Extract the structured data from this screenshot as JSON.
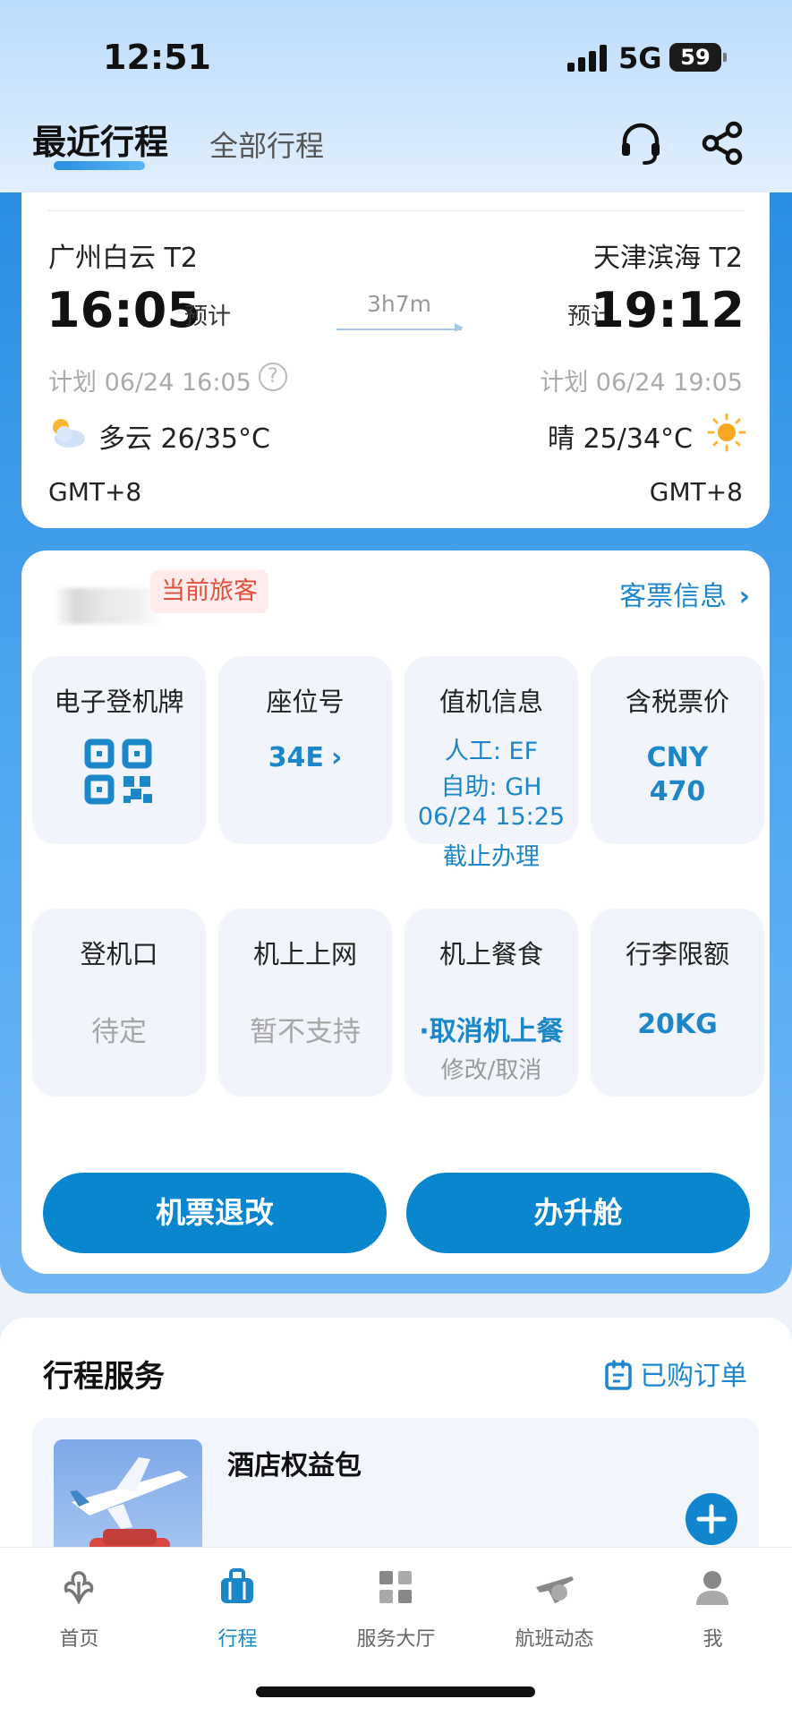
{
  "status_bar": {
    "time": "12:51",
    "network": "5G",
    "battery": "59"
  },
  "header": {
    "tabs": [
      {
        "label": "最近行程",
        "active": true
      },
      {
        "label": "全部行程",
        "active": false
      }
    ],
    "icons": [
      "headset-icon",
      "share-icon"
    ]
  },
  "flight": {
    "origin": {
      "airport": "广州白云 T2",
      "time": "16:05",
      "est_label": "预计",
      "planned": "计划 06/24 16:05",
      "weather": "多云 26/35°C",
      "timezone": "GMT+8"
    },
    "destination": {
      "airport": "天津滨海 T2",
      "time": "19:12",
      "est_label": "预计",
      "planned": "计划 06/24 19:05",
      "weather": "晴 25/34°C",
      "timezone": "GMT+8"
    },
    "duration": "3h7m"
  },
  "passenger": {
    "badge": "当前旅客",
    "ticket_link": "客票信息",
    "tiles": [
      {
        "title": "电子登机牌"
      },
      {
        "title": "座位号",
        "value": "34E"
      },
      {
        "title": "值机信息",
        "lines": [
          "人工: EF",
          "自助: GH",
          "06/24 15:25",
          "截止办理"
        ]
      },
      {
        "title": "含税票价",
        "lines": [
          "CNY",
          "470"
        ]
      },
      {
        "title": "登机口",
        "value": "待定"
      },
      {
        "title": "机上上网",
        "value": "暂不支持"
      },
      {
        "title": "机上餐食",
        "value": "·取消机上餐",
        "sub": "修改/取消"
      },
      {
        "title": "行李限额",
        "value": "20KG"
      }
    ],
    "buttons": {
      "refund": "机票退改",
      "upgrade": "办升舱"
    }
  },
  "services": {
    "title": "行程服务",
    "orders": "已购订单",
    "hotel_title": "酒店权益包"
  },
  "bottom_nav": [
    {
      "label": "首页",
      "icon": "home-icon",
      "active": false
    },
    {
      "label": "行程",
      "icon": "luggage-icon",
      "active": true
    },
    {
      "label": "服务大厅",
      "icon": "grid-icon",
      "active": false
    },
    {
      "label": "航班动态",
      "icon": "plane-icon",
      "active": false
    },
    {
      "label": "我",
      "icon": "user-icon",
      "active": false
    }
  ],
  "colors": {
    "accent": "#1b86c8",
    "button": "#0a86cf",
    "badge_text": "#e2503d"
  }
}
